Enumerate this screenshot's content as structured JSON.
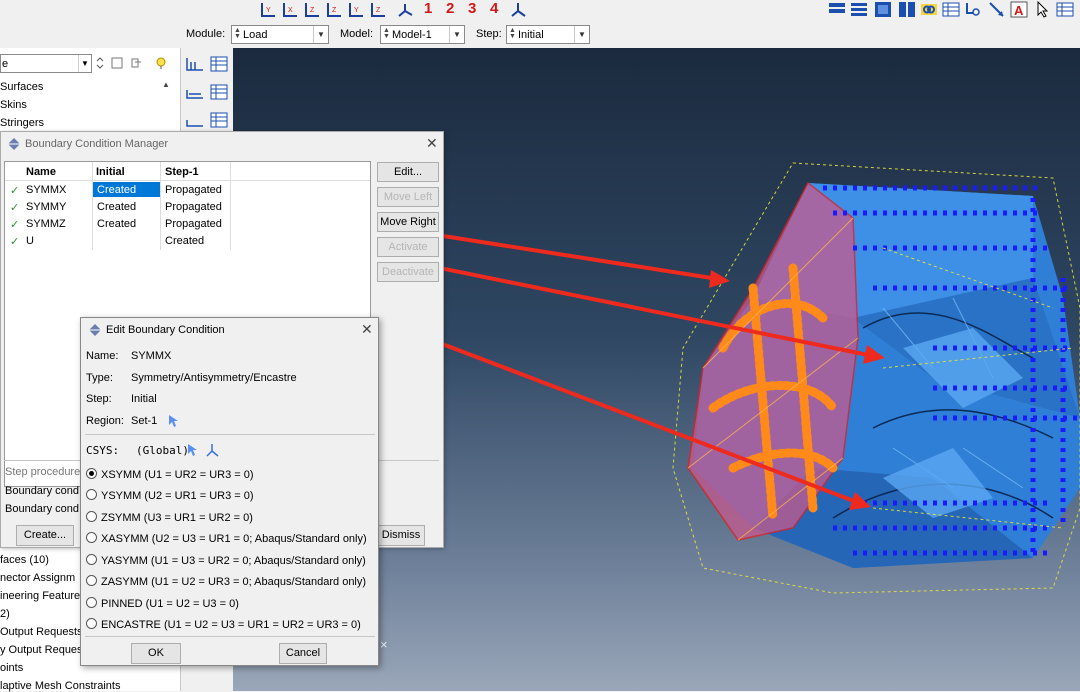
{
  "toolbar": {
    "view_numbers": [
      "1",
      "2",
      "3",
      "4"
    ],
    "accent_color": "#d01818"
  },
  "module_bar": {
    "module_label": "Module:",
    "module_value": "Load",
    "model_label": "Model:",
    "model_value": "Model-1",
    "step_label": "Step:",
    "step_value": "Initial"
  },
  "tree": {
    "combo_value": "e",
    "top_items": [
      "Surfaces",
      "Skins",
      "Stringers"
    ],
    "bottom_items": [
      "faces (10)",
      "nector Assignm",
      "ineering Feature",
      "2)",
      "Output Requests",
      "y Output Reques",
      "oints",
      "laptive Mesh Constraints"
    ]
  },
  "bc_manager": {
    "title": "Boundary Condition Manager",
    "columns": [
      "Name",
      "Initial",
      "Step-1"
    ],
    "rows": [
      {
        "name": "SYMMX",
        "initial": "Created",
        "step1": "Propagated",
        "selected": true
      },
      {
        "name": "SYMMY",
        "initial": "Created",
        "step1": "Propagated",
        "selected": false
      },
      {
        "name": "SYMMZ",
        "initial": "Created",
        "step1": "Propagated",
        "selected": false
      },
      {
        "name": "U",
        "initial": "",
        "step1": "Created",
        "selected": false
      }
    ],
    "side_buttons": [
      {
        "label": "Edit...",
        "enabled": true
      },
      {
        "label": "Move Left",
        "enabled": false
      },
      {
        "label": "Move Right",
        "enabled": true
      },
      {
        "label": "Activate",
        "enabled": false
      },
      {
        "label": "Deactivate",
        "enabled": false
      }
    ],
    "info_lines": [
      "Step procedure",
      "Boundary cond",
      "Boundary cond"
    ],
    "create_label": "Create...",
    "dismiss_label": "Dismiss"
  },
  "edit_bc": {
    "title": "Edit Boundary Condition",
    "name_label": "Name:",
    "name_value": "SYMMX",
    "type_label": "Type:",
    "type_value": "Symmetry/Antisymmetry/Encastre",
    "step_label": "Step:",
    "step_value": "Initial",
    "region_label": "Region:",
    "region_value": "Set-1",
    "csys_label": "CSYS:",
    "csys_value": "(Global)",
    "options": [
      {
        "label": "XSYMM (U1 = UR2 = UR3 = 0)",
        "selected": true
      },
      {
        "label": "YSYMM (U2 = UR1 = UR3 = 0)",
        "selected": false
      },
      {
        "label": "ZSYMM (U3 = UR1 = UR2 = 0)",
        "selected": false
      },
      {
        "label": "XASYMM (U2 = U3 = UR1 = 0; Abaqus/Standard only)",
        "selected": false
      },
      {
        "label": "YASYMM (U1 = U3 = UR2 = 0; Abaqus/Standard only)",
        "selected": false
      },
      {
        "label": "ZASYMM (U1 = U2 = UR3 = 0; Abaqus/Standard only)",
        "selected": false
      },
      {
        "label": "PINNED (U1 = U2 = U3 = 0)",
        "selected": false
      },
      {
        "label": "ENCASTRE (U1 = U2 = U3 = UR1 = UR2 = UR3 = 0)",
        "selected": false
      }
    ],
    "ok_label": "OK",
    "cancel_label": "Cancel"
  },
  "colors": {
    "annotation_arrow": "#ee2a1f",
    "part_blue": "#2f7fd6",
    "bc_marker": "#ff8a1a",
    "selection": "#0078d7"
  }
}
